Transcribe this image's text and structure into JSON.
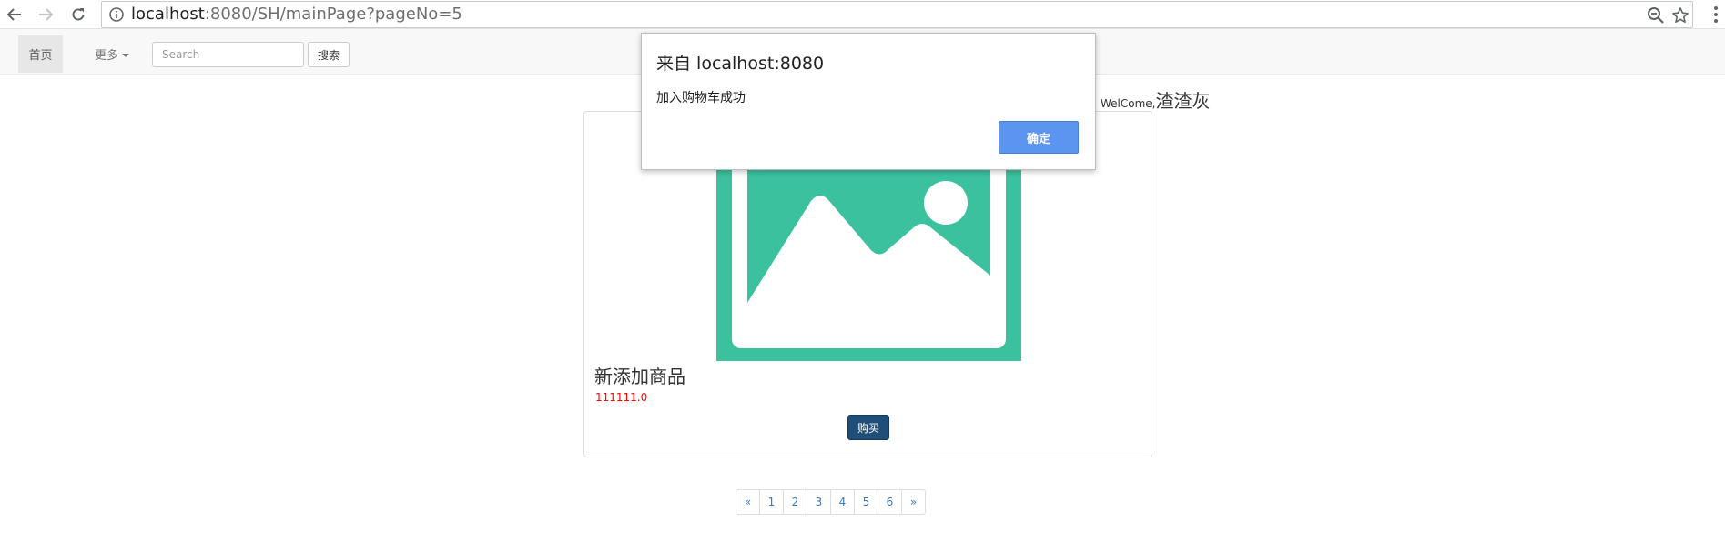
{
  "browser": {
    "url_host": "localhost",
    "url_path": ":8080/SH/mainPage?pageNo=5",
    "icons": [
      "back-arrow-icon",
      "forward-arrow-icon",
      "reload-icon",
      "info-icon",
      "zoom-out-icon",
      "bookmark-star-icon",
      "menu-dots-icon"
    ]
  },
  "navbar": {
    "home_label": "首页",
    "more_label": "更多",
    "search": {
      "value": "",
      "placeholder": "Search"
    },
    "search_button_label": "搜索"
  },
  "welcome": {
    "label": "WelCome,",
    "username": "渣渣灰"
  },
  "product": {
    "name": "新添加商品",
    "price": "111111.0",
    "buy_label": "购买",
    "image_icon": "placeholder-image-icon",
    "image_color": "#3cc19f"
  },
  "pagination": {
    "prev": "«",
    "pages": [
      "1",
      "2",
      "3",
      "4",
      "5",
      "6"
    ],
    "next": "»"
  },
  "alert": {
    "title": "来自 localhost:8080",
    "message": "加入购物车成功",
    "ok_label": "确定",
    "accent_color": "#5c95f0"
  }
}
